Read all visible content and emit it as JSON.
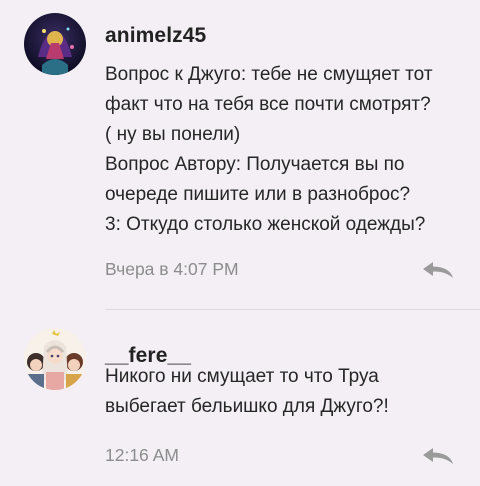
{
  "comments": [
    {
      "username": "animelz45",
      "lines": [
        "Вопрос к Джугo: тебе не смущяет тот",
        "факт что на тебя все почти смотрят?",
        "( ну вы понели)",
        "Вопрос Автору: Получается вы по",
        "очереде пишите или в разноброс?",
        "3: Откудо столько женской одежды?"
      ],
      "timestamp": "Вчера в 4:07 PM",
      "avatar_icon": "user-avatar-dark-art",
      "reply_icon": "reply-arrow-icon"
    },
    {
      "username": "__fere__",
      "lines": [
        "Никого ни смущает то что Труа",
        "выбегает бельишко для Джуго?!"
      ],
      "timestamp": "12:16 AM",
      "avatar_icon": "user-avatar-anime-group",
      "reply_icon": "reply-arrow-icon"
    }
  ],
  "colors": {
    "background": "#f3eff5",
    "text": "#262626",
    "meta": "#8c8c8c",
    "icon": "#9a9a9a"
  }
}
